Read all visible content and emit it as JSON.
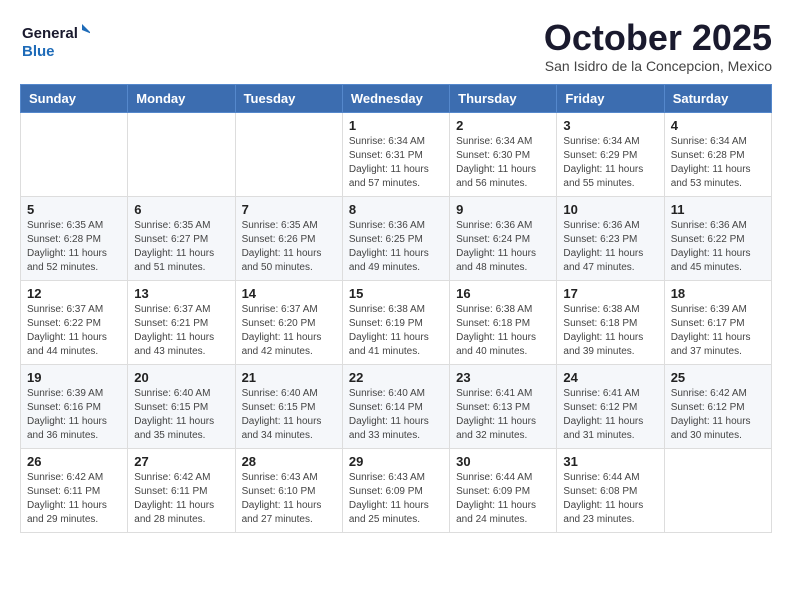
{
  "logo": {
    "line1": "General",
    "line2": "Blue"
  },
  "header": {
    "month": "October 2025",
    "location": "San Isidro de la Concepcion, Mexico"
  },
  "weekdays": [
    "Sunday",
    "Monday",
    "Tuesday",
    "Wednesday",
    "Thursday",
    "Friday",
    "Saturday"
  ],
  "weeks": [
    [
      {
        "day": "",
        "info": ""
      },
      {
        "day": "",
        "info": ""
      },
      {
        "day": "",
        "info": ""
      },
      {
        "day": "1",
        "info": "Sunrise: 6:34 AM\nSunset: 6:31 PM\nDaylight: 11 hours and 57 minutes."
      },
      {
        "day": "2",
        "info": "Sunrise: 6:34 AM\nSunset: 6:30 PM\nDaylight: 11 hours and 56 minutes."
      },
      {
        "day": "3",
        "info": "Sunrise: 6:34 AM\nSunset: 6:29 PM\nDaylight: 11 hours and 55 minutes."
      },
      {
        "day": "4",
        "info": "Sunrise: 6:34 AM\nSunset: 6:28 PM\nDaylight: 11 hours and 53 minutes."
      }
    ],
    [
      {
        "day": "5",
        "info": "Sunrise: 6:35 AM\nSunset: 6:28 PM\nDaylight: 11 hours and 52 minutes."
      },
      {
        "day": "6",
        "info": "Sunrise: 6:35 AM\nSunset: 6:27 PM\nDaylight: 11 hours and 51 minutes."
      },
      {
        "day": "7",
        "info": "Sunrise: 6:35 AM\nSunset: 6:26 PM\nDaylight: 11 hours and 50 minutes."
      },
      {
        "day": "8",
        "info": "Sunrise: 6:36 AM\nSunset: 6:25 PM\nDaylight: 11 hours and 49 minutes."
      },
      {
        "day": "9",
        "info": "Sunrise: 6:36 AM\nSunset: 6:24 PM\nDaylight: 11 hours and 48 minutes."
      },
      {
        "day": "10",
        "info": "Sunrise: 6:36 AM\nSunset: 6:23 PM\nDaylight: 11 hours and 47 minutes."
      },
      {
        "day": "11",
        "info": "Sunrise: 6:36 AM\nSunset: 6:22 PM\nDaylight: 11 hours and 45 minutes."
      }
    ],
    [
      {
        "day": "12",
        "info": "Sunrise: 6:37 AM\nSunset: 6:22 PM\nDaylight: 11 hours and 44 minutes."
      },
      {
        "day": "13",
        "info": "Sunrise: 6:37 AM\nSunset: 6:21 PM\nDaylight: 11 hours and 43 minutes."
      },
      {
        "day": "14",
        "info": "Sunrise: 6:37 AM\nSunset: 6:20 PM\nDaylight: 11 hours and 42 minutes."
      },
      {
        "day": "15",
        "info": "Sunrise: 6:38 AM\nSunset: 6:19 PM\nDaylight: 11 hours and 41 minutes."
      },
      {
        "day": "16",
        "info": "Sunrise: 6:38 AM\nSunset: 6:18 PM\nDaylight: 11 hours and 40 minutes."
      },
      {
        "day": "17",
        "info": "Sunrise: 6:38 AM\nSunset: 6:18 PM\nDaylight: 11 hours and 39 minutes."
      },
      {
        "day": "18",
        "info": "Sunrise: 6:39 AM\nSunset: 6:17 PM\nDaylight: 11 hours and 37 minutes."
      }
    ],
    [
      {
        "day": "19",
        "info": "Sunrise: 6:39 AM\nSunset: 6:16 PM\nDaylight: 11 hours and 36 minutes."
      },
      {
        "day": "20",
        "info": "Sunrise: 6:40 AM\nSunset: 6:15 PM\nDaylight: 11 hours and 35 minutes."
      },
      {
        "day": "21",
        "info": "Sunrise: 6:40 AM\nSunset: 6:15 PM\nDaylight: 11 hours and 34 minutes."
      },
      {
        "day": "22",
        "info": "Sunrise: 6:40 AM\nSunset: 6:14 PM\nDaylight: 11 hours and 33 minutes."
      },
      {
        "day": "23",
        "info": "Sunrise: 6:41 AM\nSunset: 6:13 PM\nDaylight: 11 hours and 32 minutes."
      },
      {
        "day": "24",
        "info": "Sunrise: 6:41 AM\nSunset: 6:12 PM\nDaylight: 11 hours and 31 minutes."
      },
      {
        "day": "25",
        "info": "Sunrise: 6:42 AM\nSunset: 6:12 PM\nDaylight: 11 hours and 30 minutes."
      }
    ],
    [
      {
        "day": "26",
        "info": "Sunrise: 6:42 AM\nSunset: 6:11 PM\nDaylight: 11 hours and 29 minutes."
      },
      {
        "day": "27",
        "info": "Sunrise: 6:42 AM\nSunset: 6:11 PM\nDaylight: 11 hours and 28 minutes."
      },
      {
        "day": "28",
        "info": "Sunrise: 6:43 AM\nSunset: 6:10 PM\nDaylight: 11 hours and 27 minutes."
      },
      {
        "day": "29",
        "info": "Sunrise: 6:43 AM\nSunset: 6:09 PM\nDaylight: 11 hours and 25 minutes."
      },
      {
        "day": "30",
        "info": "Sunrise: 6:44 AM\nSunset: 6:09 PM\nDaylight: 11 hours and 24 minutes."
      },
      {
        "day": "31",
        "info": "Sunrise: 6:44 AM\nSunset: 6:08 PM\nDaylight: 11 hours and 23 minutes."
      },
      {
        "day": "",
        "info": ""
      }
    ]
  ]
}
